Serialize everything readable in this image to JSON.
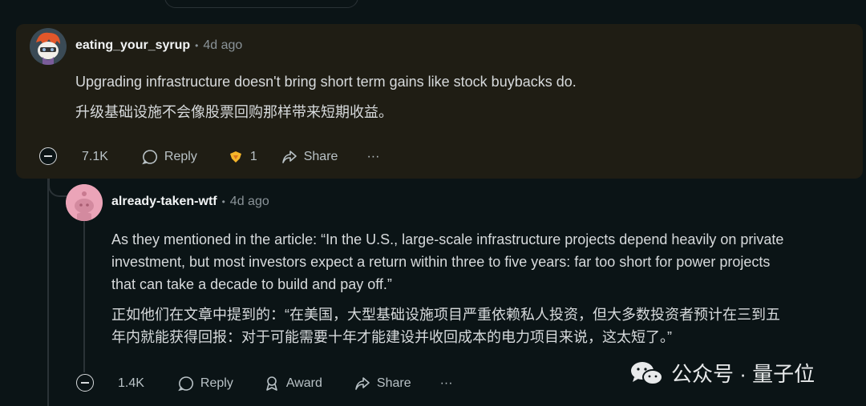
{
  "comments": [
    {
      "author": "eating_your_syrup",
      "time": "4d ago",
      "text_en": "Upgrading infrastructure doesn't bring short term gains like stock buybacks do.",
      "text_zh": "升级基础设施不会像股票回购那样带来短期收益。",
      "votes": "7.1K",
      "reply_label": "Reply",
      "award_count": "1",
      "share_label": "Share",
      "more_label": "···",
      "avatar_icon": "snoo-avatar-orange-hair",
      "highlight_color": "#1f1d14"
    },
    {
      "author": "already-taken-wtf",
      "time": "4d ago",
      "text_en_1": "As they mentioned in the article: “In the U.S., large-scale infrastructure projects depend heavily on private",
      "text_en_2": "investment, but most investors expect a return within three to five years: far too short for power projects",
      "text_en_3": "that can take a decade to build and pay off.”",
      "text_zh_1": "正如他们在文章中提到的：“在美国，大型基础设施项目严重依赖私人投资，但大多数投资者预计在三到五",
      "text_zh_2": "年内就能获得回报：对于可能需要十年才能建设并收回成本的电力项目来说，这太短了。”",
      "votes": "1.4K",
      "reply_label": "Reply",
      "award_label": "Award",
      "share_label": "Share",
      "more_label": "···",
      "avatar_icon": "snoo-avatar-pink"
    }
  ],
  "separator": "•",
  "watermark": {
    "text": "公众号 · 量子位",
    "icon": "wechat-icon"
  }
}
